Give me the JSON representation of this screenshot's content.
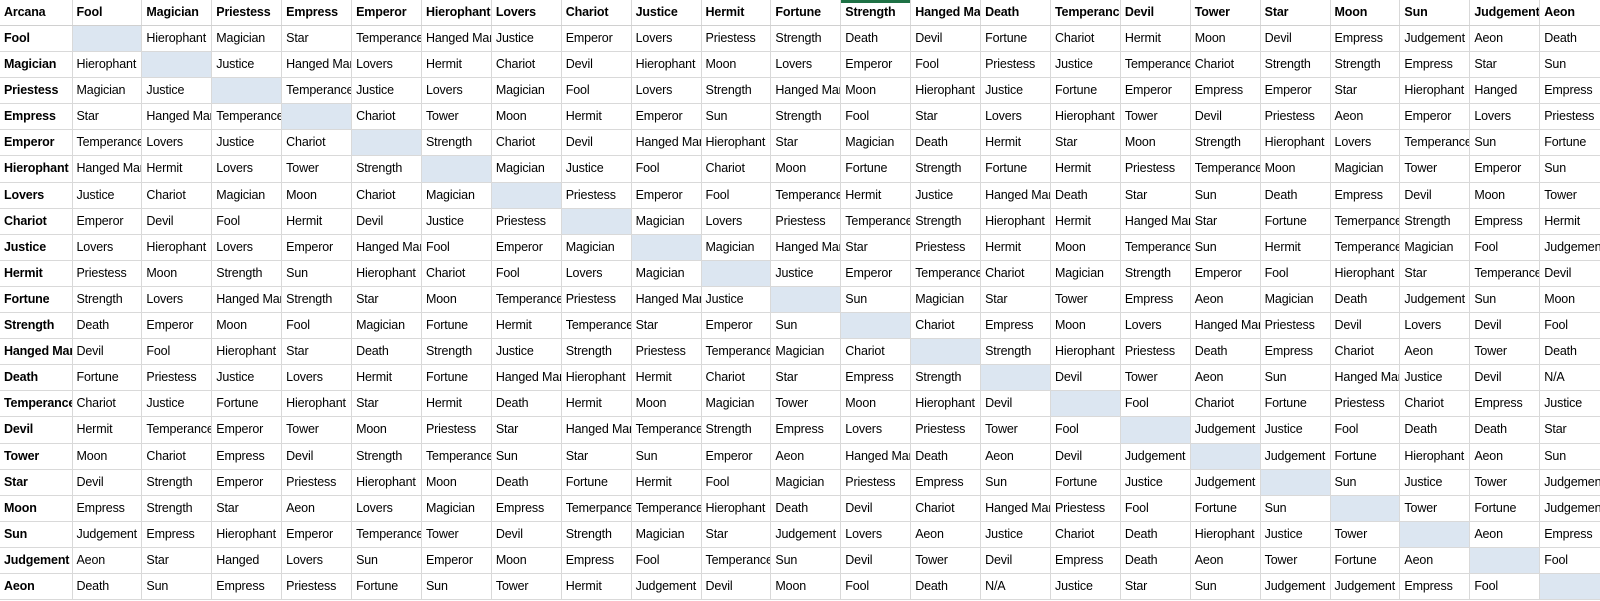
{
  "meta": {
    "corner_label": "Arcana",
    "accent_color": "#1e7145",
    "diagonal_color": "#dce6f1",
    "grid_color": "#d9d9d9",
    "accent_column": "Strength"
  },
  "columns": [
    "Arcana",
    "Fool",
    "Magician",
    "Priestess",
    "Empress",
    "Emperor",
    "Hierophant",
    "Lovers",
    "Chariot",
    "Justice",
    "Hermit",
    "Fortune",
    "Strength",
    "Hanged Man",
    "Death",
    "Temperance",
    "Devil",
    "Tower",
    "Star",
    "Moon",
    "Sun",
    "Judgement",
    "Aeon"
  ],
  "rows": [
    {
      "label": "Fool",
      "cells": [
        "",
        "Hierophant",
        "Magician",
        "Star",
        "Temperance",
        "Hanged Man",
        "Justice",
        "Emperor",
        "Lovers",
        "Priestess",
        "Strength",
        "Death",
        "Devil",
        "Fortune",
        "Chariot",
        "Hermit",
        "Moon",
        "Devil",
        "Empress",
        "Judgement",
        "Aeon",
        "Death"
      ]
    },
    {
      "label": "Magician",
      "cells": [
        "Hierophant",
        "",
        "Justice",
        "Hanged Man",
        "Lovers",
        "Hermit",
        "Chariot",
        "Devil",
        "Hierophant",
        "Moon",
        "Lovers",
        "Emperor",
        "Fool",
        "Priestess",
        "Justice",
        "Temperance",
        "Chariot",
        "Strength",
        "Strength",
        "Empress",
        "Star",
        "Sun"
      ]
    },
    {
      "label": "Priestess",
      "cells": [
        "Magician",
        "Justice",
        "",
        "Temperance",
        "Justice",
        "Lovers",
        "Magician",
        "Fool",
        "Lovers",
        "Strength",
        "Hanged Man",
        "Moon",
        "Hierophant",
        "Justice",
        "Fortune",
        "Emperor",
        "Empress",
        "Emperor",
        "Star",
        "Hierophant",
        "Hanged",
        "Empress"
      ]
    },
    {
      "label": "Empress",
      "cells": [
        "Star",
        "Hanged Man",
        "Temperance",
        "",
        "Chariot",
        "Tower",
        "Moon",
        "Hermit",
        "Emperor",
        "Sun",
        "Strength",
        "Fool",
        "Star",
        "Lovers",
        "Hierophant",
        "Tower",
        "Devil",
        "Priestess",
        "Aeon",
        "Emperor",
        "Lovers",
        "Priestess"
      ]
    },
    {
      "label": "Emperor",
      "cells": [
        "Temperance",
        "Lovers",
        "Justice",
        "Chariot",
        "",
        "Strength",
        "Chariot",
        "Devil",
        "Hanged Man",
        "Hierophant",
        "Star",
        "Magician",
        "Death",
        "Hermit",
        "Star",
        "Moon",
        "Strength",
        "Hierophant",
        "Lovers",
        "Temperance",
        "Sun",
        "Fortune"
      ]
    },
    {
      "label": "Hierophant",
      "cells": [
        "Hanged Man",
        "Hermit",
        "Lovers",
        "Tower",
        "Strength",
        "",
        "Magician",
        "Justice",
        "Fool",
        "Chariot",
        "Moon",
        "Fortune",
        "Strength",
        "Fortune",
        "Hermit",
        "Priestess",
        "Temperance",
        "Moon",
        "Magician",
        "Tower",
        "Emperor",
        "Sun"
      ]
    },
    {
      "label": "Lovers",
      "cells": [
        "Justice",
        "Chariot",
        "Magician",
        "Moon",
        "Chariot",
        "Magician",
        "",
        "Priestess",
        "Emperor",
        "Fool",
        "Temperance",
        "Hermit",
        "Justice",
        "Hanged Man",
        "Death",
        "Star",
        "Sun",
        "Death",
        "Empress",
        "Devil",
        "Moon",
        "Tower"
      ]
    },
    {
      "label": "Chariot",
      "cells": [
        "Emperor",
        "Devil",
        "Fool",
        "Hermit",
        "Devil",
        "Justice",
        "Priestess",
        "",
        "Magician",
        "Lovers",
        "Priestess",
        "Temperance",
        "Strength",
        "Hierophant",
        "Hermit",
        "Hanged Man",
        "Star",
        "Fortune",
        "Temerpance",
        "Strength",
        "Empress",
        "Hermit"
      ]
    },
    {
      "label": "Justice",
      "cells": [
        "Lovers",
        "Hierophant",
        "Lovers",
        "Emperor",
        "Hanged Man",
        "Fool",
        "Emperor",
        "Magician",
        "",
        "Magician",
        "Hanged Man",
        "Star",
        "Priestess",
        "Hermit",
        "Moon",
        "Temperance",
        "Sun",
        "Hermit",
        "Temperance",
        "Magician",
        "Fool",
        "Judgement"
      ]
    },
    {
      "label": "Hermit",
      "cells": [
        "Priestess",
        "Moon",
        "Strength",
        "Sun",
        "Hierophant",
        "Chariot",
        "Fool",
        "Lovers",
        "Magician",
        "",
        "Justice",
        "Emperor",
        "Temperance",
        "Chariot",
        "Magician",
        "Strength",
        "Emperor",
        "Fool",
        "Hierophant",
        "Star",
        "Temperance",
        "Devil"
      ]
    },
    {
      "label": "Fortune",
      "cells": [
        "Strength",
        "Lovers",
        "Hanged Man",
        "Strength",
        "Star",
        "Moon",
        "Temperance",
        "Priestess",
        "Hanged Man",
        "Justice",
        "",
        "Sun",
        "Magician",
        "Star",
        "Tower",
        "Empress",
        "Aeon",
        "Magician",
        "Death",
        "Judgement",
        "Sun",
        "Moon"
      ]
    },
    {
      "label": "Strength",
      "cells": [
        "Death",
        "Emperor",
        "Moon",
        "Fool",
        "Magician",
        "Fortune",
        "Hermit",
        "Temperance",
        "Star",
        "Emperor",
        "Sun",
        "",
        "Chariot",
        "Empress",
        "Moon",
        "Lovers",
        "Hanged Man",
        "Priestess",
        "Devil",
        "Lovers",
        "Devil",
        "Fool"
      ]
    },
    {
      "label": "Hanged Man",
      "cells": [
        "Devil",
        "Fool",
        "Hierophant",
        "Star",
        "Death",
        "Strength",
        "Justice",
        "Strength",
        "Priestess",
        "Temperance",
        "Magician",
        "Chariot",
        "",
        "Strength",
        "Hierophant",
        "Priestess",
        "Death",
        "Empress",
        "Chariot",
        "Aeon",
        "Tower",
        "Death"
      ]
    },
    {
      "label": "Death",
      "cells": [
        "Fortune",
        "Priestess",
        "Justice",
        "Lovers",
        "Hermit",
        "Fortune",
        "Hanged Man",
        "Hierophant",
        "Hermit",
        "Chariot",
        "Star",
        "Empress",
        "Strength",
        "",
        "Devil",
        "Tower",
        "Aeon",
        "Sun",
        "Hanged Man",
        "Justice",
        "Devil",
        "N/A"
      ]
    },
    {
      "label": "Temperance",
      "cells": [
        "Chariot",
        "Justice",
        "Fortune",
        "Hierophant",
        "Star",
        "Hermit",
        "Death",
        "Hermit",
        "Moon",
        "Magician",
        "Tower",
        "Moon",
        "Hierophant",
        "Devil",
        "",
        "Fool",
        "Chariot",
        "Fortune",
        "Priestess",
        "Chariot",
        "Empress",
        "Justice"
      ]
    },
    {
      "label": "Devil",
      "cells": [
        "Hermit",
        "Temperance",
        "Emperor",
        "Tower",
        "Moon",
        "Priestess",
        "Star",
        "Hanged Man",
        "Temperance",
        "Strength",
        "Empress",
        "Lovers",
        "Priestess",
        "Tower",
        "Fool",
        "",
        "Judgement",
        "Justice",
        "Fool",
        "Death",
        "Death",
        "Star"
      ]
    },
    {
      "label": "Tower",
      "cells": [
        "Moon",
        "Chariot",
        "Empress",
        "Devil",
        "Strength",
        "Temperance",
        "Sun",
        "Star",
        "Sun",
        "Emperor",
        "Aeon",
        "Hanged Man",
        "Death",
        "Aeon",
        "Devil",
        "Judgement",
        "",
        "Judgement",
        "Fortune",
        "Hierophant",
        "Aeon",
        "Sun"
      ]
    },
    {
      "label": "Star",
      "cells": [
        "Devil",
        "Strength",
        "Emperor",
        "Priestess",
        "Hierophant",
        "Moon",
        "Death",
        "Fortune",
        "Hermit",
        "Fool",
        "Magician",
        "Priestess",
        "Empress",
        "Sun",
        "Fortune",
        "Justice",
        "Judgement",
        "",
        "Sun",
        "Justice",
        "Tower",
        "Judgement"
      ]
    },
    {
      "label": "Moon",
      "cells": [
        "Empress",
        "Strength",
        "Star",
        "Aeon",
        "Lovers",
        "Magician",
        "Empress",
        "Temerpance",
        "Temperance",
        "Hierophant",
        "Death",
        "Devil",
        "Chariot",
        "Hanged Man",
        "Priestess",
        "Fool",
        "Fortune",
        "Sun",
        "",
        "Tower",
        "Fortune",
        "Judgement"
      ]
    },
    {
      "label": "Sun",
      "cells": [
        "Judgement",
        "Empress",
        "Hierophant",
        "Emperor",
        "Temperance",
        "Tower",
        "Devil",
        "Strength",
        "Magician",
        "Star",
        "Judgement",
        "Lovers",
        "Aeon",
        "Justice",
        "Chariot",
        "Death",
        "Hierophant",
        "Justice",
        "Tower",
        "",
        "Aeon",
        "Empress"
      ]
    },
    {
      "label": "Judgement",
      "cells": [
        "Aeon",
        "Star",
        "Hanged",
        "Lovers",
        "Sun",
        "Emperor",
        "Moon",
        "Empress",
        "Fool",
        "Temperance",
        "Sun",
        "Devil",
        "Tower",
        "Devil",
        "Empress",
        "Death",
        "Aeon",
        "Tower",
        "Fortune",
        "Aeon",
        "",
        "Fool"
      ]
    },
    {
      "label": "Aeon",
      "cells": [
        "Death",
        "Sun",
        "Empress",
        "Priestess",
        "Fortune",
        "Sun",
        "Tower",
        "Hermit",
        "Judgement",
        "Devil",
        "Moon",
        "Fool",
        "Death",
        "N/A",
        "Justice",
        "Star",
        "Sun",
        "Judgement",
        "Judgement",
        "Empress",
        "Fool",
        ""
      ]
    }
  ]
}
